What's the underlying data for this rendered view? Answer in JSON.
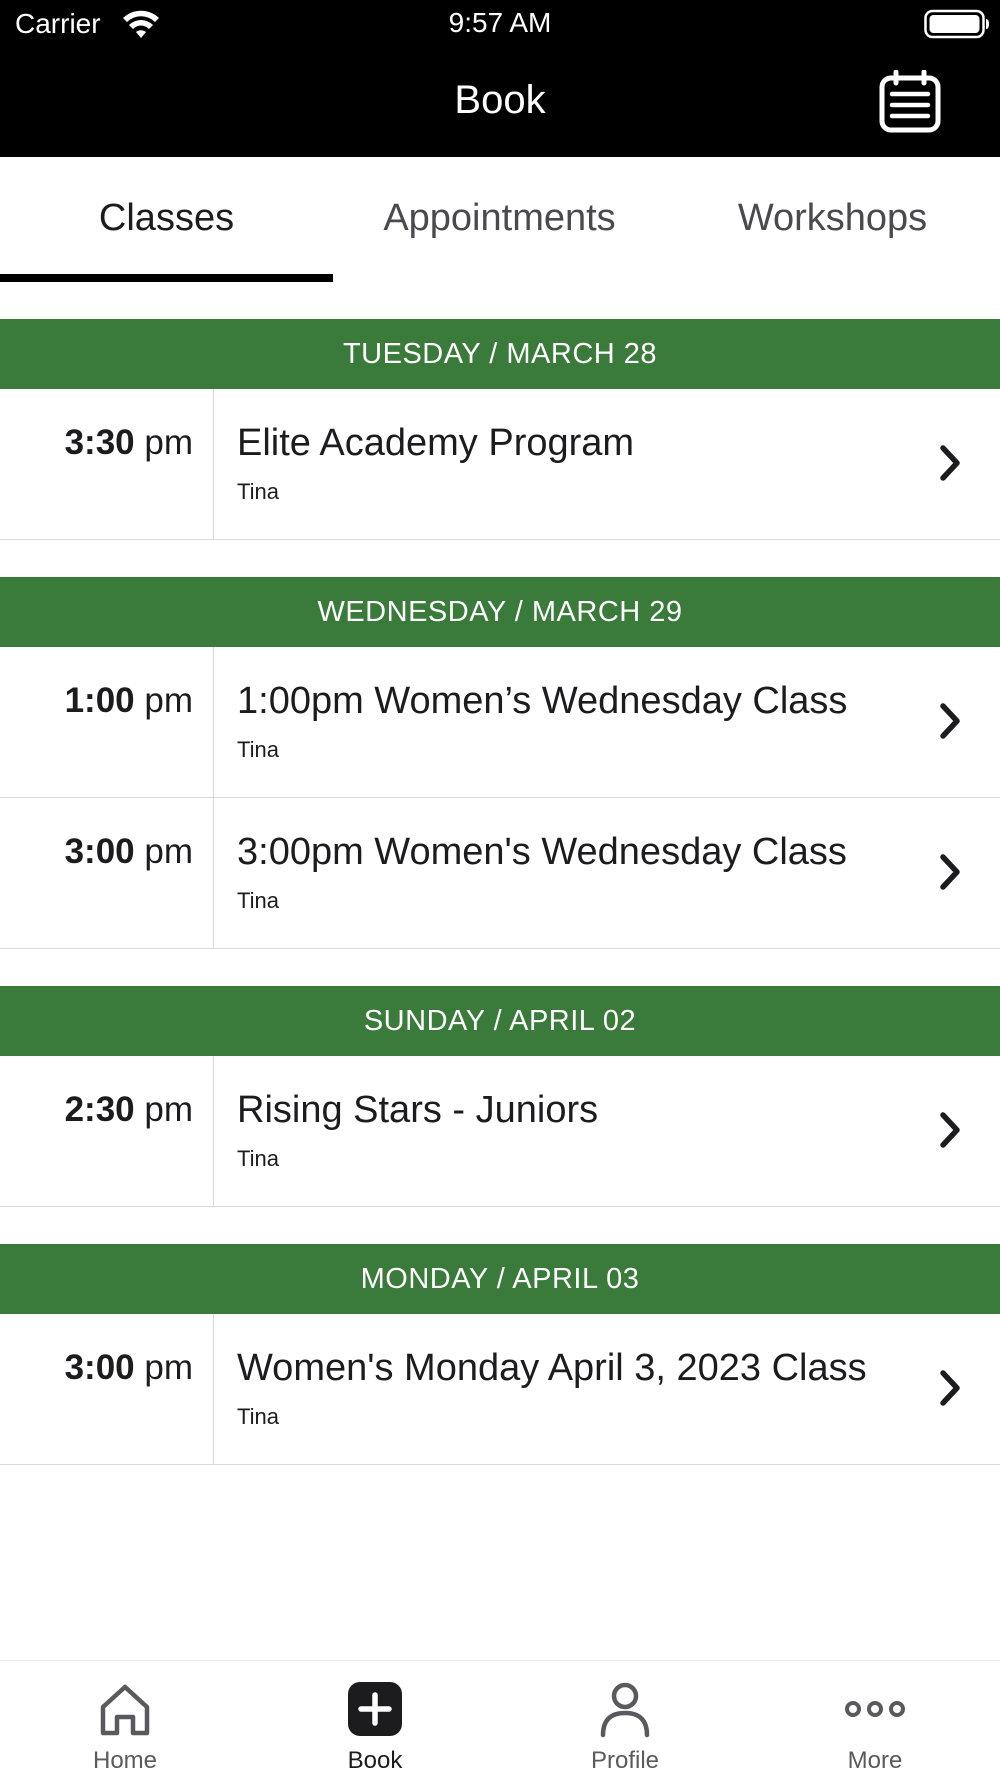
{
  "status_bar": {
    "carrier": "Carrier",
    "time": "9:57 AM"
  },
  "header": {
    "title": "Book",
    "calendar_icon": "calendar-icon"
  },
  "tabs": [
    {
      "label": "Classes",
      "active": true
    },
    {
      "label": "Appointments",
      "active": false
    },
    {
      "label": "Workshops",
      "active": false
    }
  ],
  "days": [
    {
      "header": "TUESDAY / MARCH 28",
      "classes": [
        {
          "time": "3:30",
          "ampm": "pm",
          "title": "Elite Academy Program",
          "instructor": "Tina"
        }
      ]
    },
    {
      "header": "WEDNESDAY / MARCH 29",
      "classes": [
        {
          "time": "1:00",
          "ampm": "pm",
          "title": "1:00pm Women’s Wednesday Class",
          "instructor": "Tina"
        },
        {
          "time": "3:00",
          "ampm": "pm",
          "title": "3:00pm Women's Wednesday Class",
          "instructor": "Tina"
        }
      ]
    },
    {
      "header": "SUNDAY / APRIL 02",
      "classes": [
        {
          "time": "2:30",
          "ampm": "pm",
          "title": "Rising Stars - Juniors",
          "instructor": "Tina"
        }
      ]
    },
    {
      "header": "MONDAY / APRIL 03",
      "classes": [
        {
          "time": "3:00",
          "ampm": "pm",
          "title": "Women's Monday April 3, 2023 Class",
          "instructor": "Tina"
        }
      ]
    }
  ],
  "bottom_nav": [
    {
      "label": "Home",
      "icon": "home-icon",
      "active": false
    },
    {
      "label": "Book",
      "icon": "plus-square-icon",
      "active": true
    },
    {
      "label": "Profile",
      "icon": "person-icon",
      "active": false
    },
    {
      "label": "More",
      "icon": "more-dots-icon",
      "active": false
    }
  ],
  "colors": {
    "day_header_bg": "#3a7a3a",
    "header_bg": "#000000"
  }
}
